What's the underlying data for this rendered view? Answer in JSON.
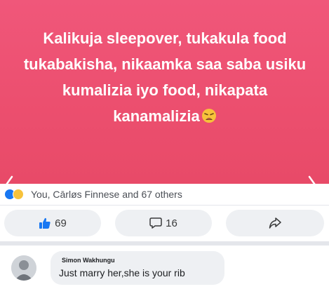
{
  "post": {
    "line1": "Kalikuja sleepover, tukakula food",
    "line2": "tukabakisha, nikaamka saa saba usiku",
    "line3": "kumalizia iyo food, nikapata",
    "line4": "kanamalizia",
    "background_color": "#ee5474",
    "text_color": "#ffffff",
    "trailing_emoji": "weary-face-icon"
  },
  "reactions": {
    "summary": "You, Cārløs Finnese and 67 others",
    "icons": [
      "like-reaction-icon",
      "haha-reaction-icon"
    ]
  },
  "actions": {
    "like_count": "69",
    "comment_count": "16",
    "share_icon": "share-arrow-icon"
  },
  "comment": {
    "author": "Simon Wakhungu",
    "text": "Just marry her,she is your rib"
  }
}
